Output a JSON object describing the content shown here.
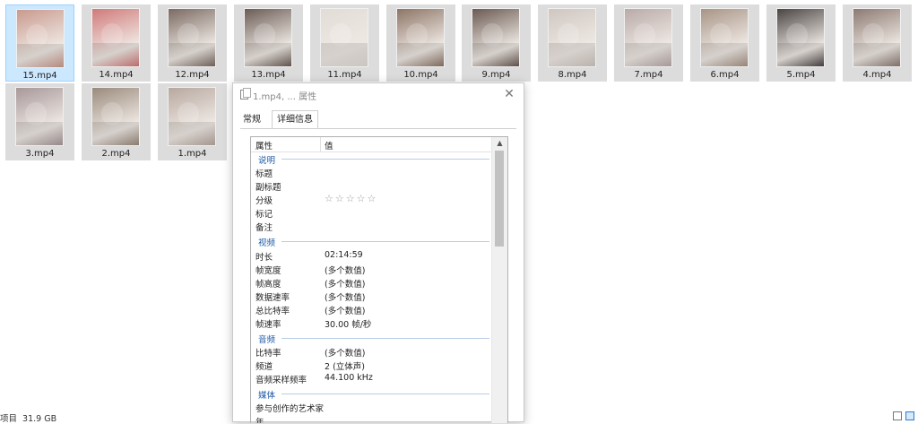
{
  "files": [
    {
      "name": "15.mp4",
      "selected": true,
      "tint": "#c99a8e"
    },
    {
      "name": "14.mp4",
      "selected": false,
      "tint": "#d07a7a"
    },
    {
      "name": "12.mp4",
      "selected": false,
      "tint": "#7a6a62"
    },
    {
      "name": "13.mp4",
      "selected": false,
      "tint": "#6b5c55"
    },
    {
      "name": "11.mp4",
      "selected": false,
      "tint": "#e2dcd6"
    },
    {
      "name": "10.mp4",
      "selected": false,
      "tint": "#8d7566"
    },
    {
      "name": "9.mp4",
      "selected": false,
      "tint": "#6a5a52"
    },
    {
      "name": "8.mp4",
      "selected": false,
      "tint": "#cfc6c0"
    },
    {
      "name": "7.mp4",
      "selected": false,
      "tint": "#b9aaa8"
    },
    {
      "name": "6.mp4",
      "selected": false,
      "tint": "#a89486"
    },
    {
      "name": "5.mp4",
      "selected": false,
      "tint": "#4a4444"
    },
    {
      "name": "4.mp4",
      "selected": false,
      "tint": "#8c7a72"
    },
    {
      "name": "3.mp4",
      "selected": false,
      "tint": "#a8989a"
    },
    {
      "name": "2.mp4",
      "selected": false,
      "tint": "#9a8a7c"
    },
    {
      "name": "1.mp4",
      "selected": false,
      "tint": "#b7a89f"
    }
  ],
  "status_bar": {
    "text": "项目  31.9 GB"
  },
  "dialog": {
    "title": "1.mp4, ... 属性",
    "close_glyph": "✕",
    "tabs": [
      "常规",
      "详细信息"
    ],
    "active_tab": 1,
    "header": {
      "property": "属性",
      "value": "值"
    },
    "sections": {
      "description": {
        "title": "说明",
        "rows": [
          {
            "key": "标题",
            "value": ""
          },
          {
            "key": "副标题",
            "value": ""
          },
          {
            "key": "分级",
            "value": ""
          },
          {
            "key": "标记",
            "value": ""
          },
          {
            "key": "备注",
            "value": ""
          }
        ],
        "rating_stars": "☆☆☆☆☆"
      },
      "video": {
        "title": "视频",
        "rows": [
          {
            "key": "时长",
            "value": "02:14:59"
          },
          {
            "key": "帧宽度",
            "value": "(多个数值)"
          },
          {
            "key": "帧高度",
            "value": "(多个数值)"
          },
          {
            "key": "数据速率",
            "value": "(多个数值)"
          },
          {
            "key": "总比特率",
            "value": "(多个数值)"
          },
          {
            "key": "帧速率",
            "value": "30.00 帧/秒"
          }
        ]
      },
      "audio": {
        "title": "音频",
        "rows": [
          {
            "key": "比特率",
            "value": "(多个数值)"
          },
          {
            "key": "频道",
            "value": "2 (立体声)"
          },
          {
            "key": "音频采样频率",
            "value": "44.100 kHz"
          }
        ]
      },
      "media": {
        "title": "媒体",
        "rows": [
          {
            "key": "参与创作的艺术家",
            "value": ""
          },
          {
            "key": "年",
            "value": ""
          }
        ]
      }
    },
    "scroll_up_glyph": "▲"
  },
  "icons": {
    "dialog_icon": "properties-icon",
    "view_details": "details-view-icon",
    "view_large": "large-icons-view-icon"
  }
}
